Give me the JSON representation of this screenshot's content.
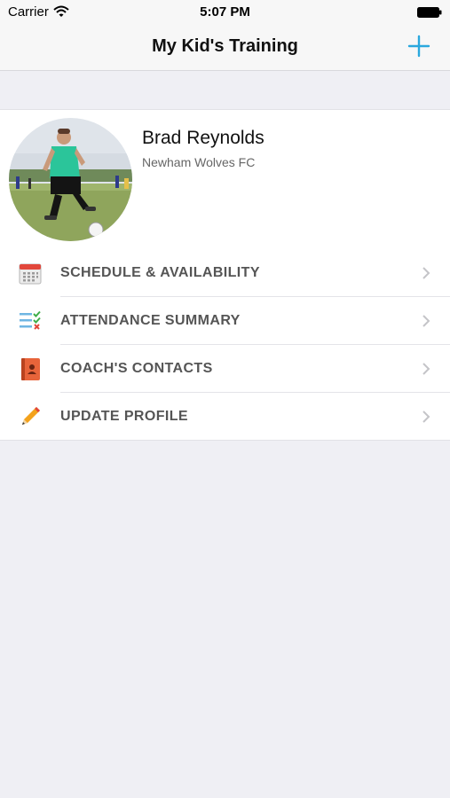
{
  "status_bar": {
    "carrier": "Carrier",
    "time": "5:07 PM",
    "wifi_icon": "wifi-icon",
    "battery_icon": "battery-icon"
  },
  "nav": {
    "title": "My Kid's Training",
    "add_icon": "plus-icon",
    "accent_color": "#2aa8de"
  },
  "profile": {
    "name": "Brad Reynolds",
    "team": "Newham Wolves FC",
    "avatar": "player-photo"
  },
  "menu": {
    "items": [
      {
        "label": "SCHEDULE & AVAILABILITY",
        "icon": "calendar-icon"
      },
      {
        "label": "ATTENDANCE SUMMARY",
        "icon": "checklist-icon"
      },
      {
        "label": "COACH'S CONTACTS",
        "icon": "contacts-book-icon"
      },
      {
        "label": "UPDATE PROFILE",
        "icon": "pencil-icon"
      }
    ],
    "chevron_icon": "chevron-right-icon"
  }
}
